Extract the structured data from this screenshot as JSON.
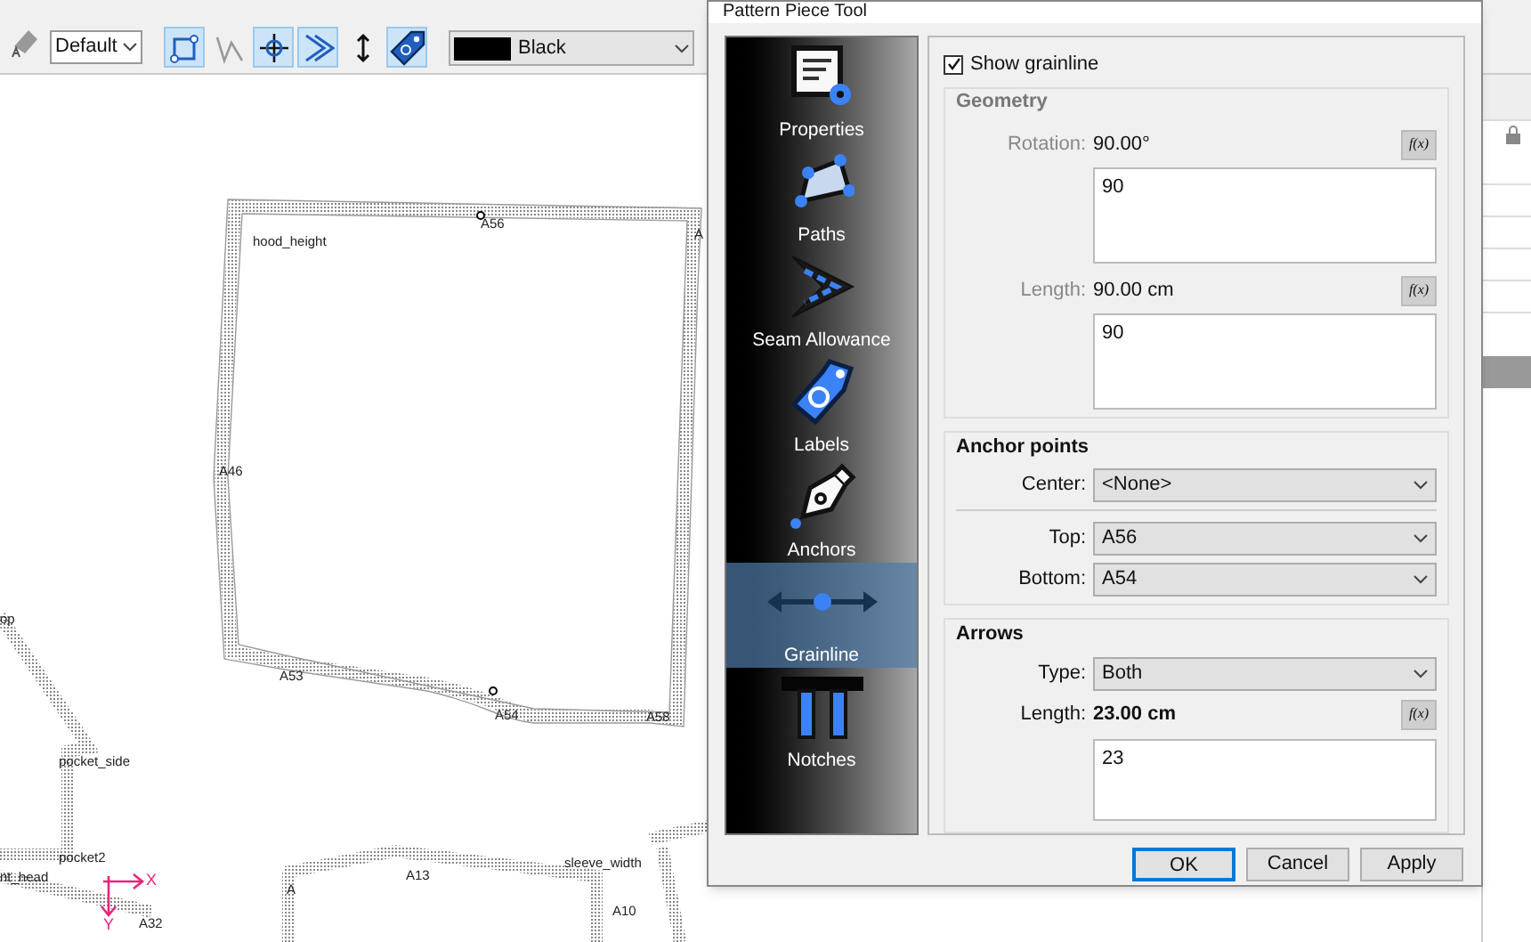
{
  "toolbar": {
    "line_type": "Default",
    "tools": [
      {
        "selected": true
      },
      {
        "selected": false
      },
      {
        "selected": true
      },
      {
        "selected": true
      },
      {
        "selected": false
      },
      {
        "selected": true
      }
    ],
    "color": {
      "name": "Black",
      "color": "#000000"
    }
  },
  "canvas": {
    "labels": [
      "hood_height",
      "A56",
      "A",
      "A46",
      "A53",
      "A54",
      "A58",
      "op",
      "pocket_side",
      "pocket2",
      "nt_head",
      "A32",
      "A",
      "A13",
      "sleeve_width",
      "A10"
    ],
    "axes": [
      "X",
      "Y"
    ]
  },
  "dialog": {
    "title": "Pattern Piece Tool",
    "sidebar": {
      "items": [
        {
          "label": "Properties",
          "selected": false
        },
        {
          "label": "Paths",
          "selected": false
        },
        {
          "label": "Seam Allowance",
          "selected": false
        },
        {
          "label": "Labels",
          "selected": false
        },
        {
          "label": "Anchors",
          "selected": false
        },
        {
          "label": "Grainline",
          "selected": true
        },
        {
          "label": "Notches",
          "selected": false
        }
      ]
    },
    "show_grainline": {
      "label": "Show grainline",
      "checked": true
    },
    "geometry": {
      "title": "Geometry",
      "rotation": {
        "label": "Rotation:",
        "value": "90.00°",
        "fx": "f(x)",
        "formula": "90"
      },
      "length": {
        "label": "Length:",
        "value": "90.00 cm",
        "fx": "f(x)",
        "formula": "90"
      }
    },
    "anchor_points": {
      "title": "Anchor points",
      "center": {
        "label": "Center:",
        "value": "<None>"
      },
      "top": {
        "label": "Top:",
        "value": "A56"
      },
      "bottom": {
        "label": "Bottom:",
        "value": "A54"
      }
    },
    "arrows": {
      "title": "Arrows",
      "type": {
        "label": "Type:",
        "value": "Both"
      },
      "length": {
        "label": "Length:",
        "value": "23.00 cm",
        "fx": "f(x)",
        "formula": "23"
      }
    },
    "buttons": [
      {
        "label": "OK",
        "default": true
      },
      {
        "label": "Cancel",
        "default": false
      },
      {
        "label": "Apply",
        "default": false
      }
    ]
  }
}
